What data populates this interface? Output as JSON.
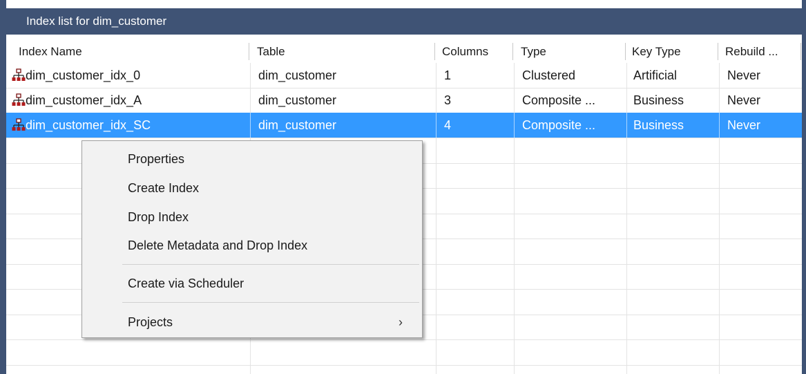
{
  "window": {
    "title": "Index list for dim_customer"
  },
  "columns": [
    "Index Name",
    "Table",
    "Columns",
    "Type",
    "Key Type",
    "Rebuild ..."
  ],
  "rows": [
    {
      "name": "dim_customer_idx_0",
      "table": "dim_customer",
      "columns": "1",
      "type": "Clustered",
      "key_type": "Artificial",
      "rebuild": "Never",
      "selected": false
    },
    {
      "name": "dim_customer_idx_A",
      "table": "dim_customer",
      "columns": "3",
      "type": "Composite ...",
      "key_type": "Business",
      "rebuild": "Never",
      "selected": false
    },
    {
      "name": "dim_customer_idx_SC",
      "table": "dim_customer",
      "columns": "4",
      "type": "Composite ...",
      "key_type": "Business",
      "rebuild": "Never",
      "selected": true
    }
  ],
  "context_menu": {
    "items": [
      "Properties",
      "Create Index",
      "Drop Index",
      "Delete Metadata and Drop Index",
      "Create via Scheduler",
      "Projects"
    ],
    "projects_arrow": "›"
  },
  "colors": {
    "titlebar": "#3f5375",
    "selection": "#3399ff",
    "icon": "#8b1a1a"
  },
  "icons": {
    "row_icon": "index-hierarchy-icon",
    "submenu": "chevron-right-icon"
  }
}
